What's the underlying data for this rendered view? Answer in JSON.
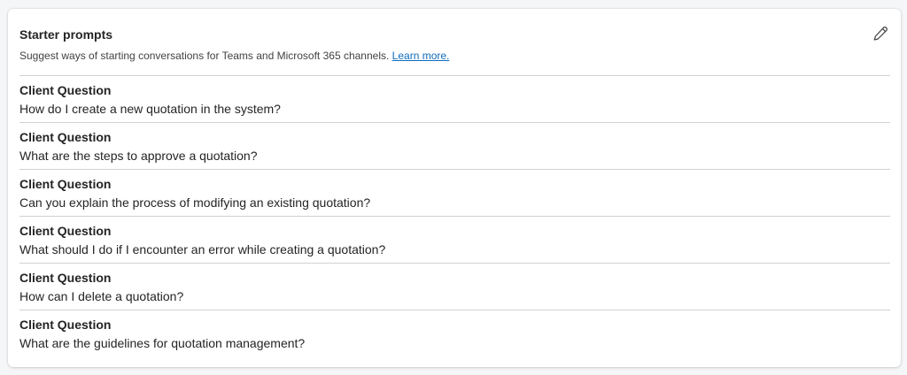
{
  "card": {
    "title": "Starter prompts",
    "subtitle": "Suggest ways of starting conversations for Teams and Microsoft 365 channels.",
    "learn_more": "Learn more.",
    "edit_icon": "pencil-icon"
  },
  "prompts": [
    {
      "title": "Client Question",
      "text": "How do I create a new quotation in the system?"
    },
    {
      "title": "Client Question",
      "text": "What are the steps to approve a quotation?"
    },
    {
      "title": "Client Question",
      "text": "Can you explain the process of modifying an existing quotation?"
    },
    {
      "title": "Client Question",
      "text": "What should I do if I encounter an error while creating a quotation?"
    },
    {
      "title": "Client Question",
      "text": "How can I delete a quotation?"
    },
    {
      "title": "Client Question",
      "text": "What are the guidelines for quotation management?"
    }
  ],
  "colors": {
    "link": "#0f6cbd",
    "divider": "#d1d1d1"
  }
}
